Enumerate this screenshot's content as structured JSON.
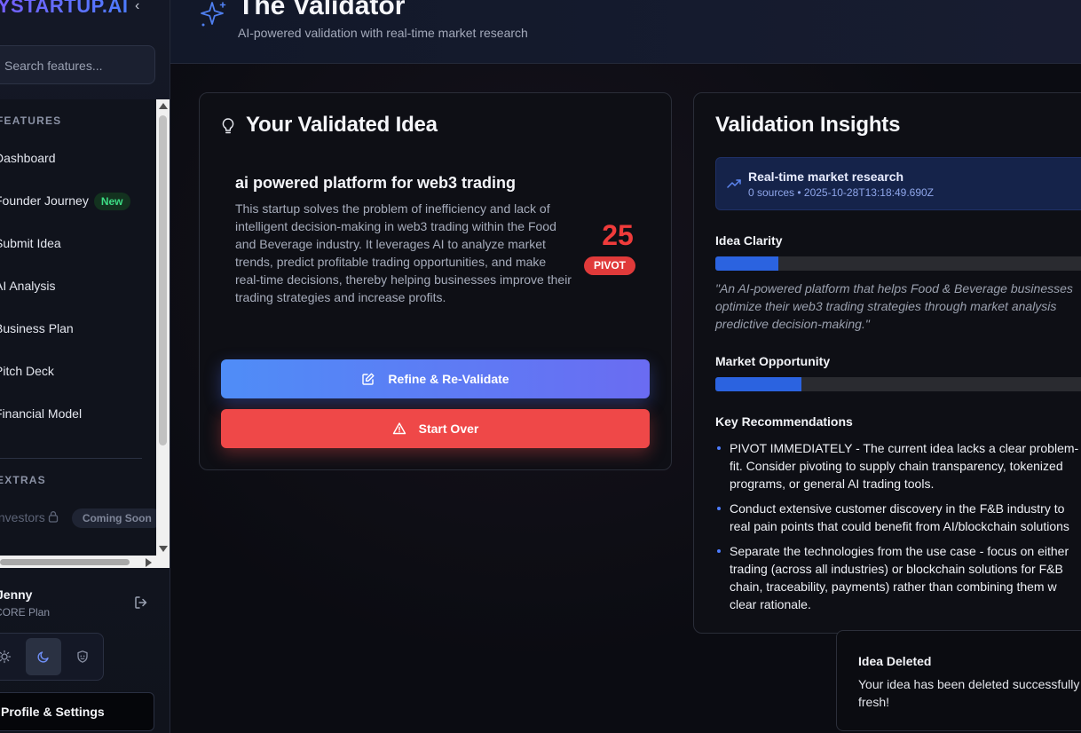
{
  "sidebar": {
    "brand": "MYSTARTUP.AI",
    "search_placeholder": "Search features...",
    "sections": {
      "features": "FEATURES",
      "extras": "EXTRAS"
    },
    "items": [
      {
        "label": "Dashboard"
      },
      {
        "label": "Founder Journey",
        "badge": "New"
      },
      {
        "label": "Submit Idea"
      },
      {
        "label": "AI Analysis"
      },
      {
        "label": "Business Plan"
      },
      {
        "label": "Pitch Deck"
      },
      {
        "label": "Financial Model"
      }
    ],
    "extras_item": {
      "label": "Investors",
      "badge": "Coming Soon"
    },
    "user": {
      "name": "Jenny",
      "plan": "CORE Plan"
    },
    "settings_label": "Profile & Settings"
  },
  "header": {
    "title": "The Validator",
    "subtitle": "AI-powered validation with real-time market research"
  },
  "idea_card": {
    "title": "Your Validated Idea",
    "idea_name": "ai powered platform for web3 trading",
    "description": "This startup solves the problem of inefficiency and lack of intelligent decision-making in web3 trading within the Food and Beverage industry. It leverages AI to analyze market trends, predict profitable trading opportunities, and make real-time decisions, thereby helping businesses improve their trading strategies and increase profits.",
    "score": "25",
    "verdict": "PIVOT",
    "refine_label": "Refine & Re-Validate",
    "start_over_label": "Start Over"
  },
  "insights": {
    "title": "Validation Insights",
    "research_title": "Real-time market research",
    "research_meta": "0 sources • 2025-10-28T13:18:49.690Z",
    "clarity_label": "Idea Clarity",
    "clarity_fraction": 0.17,
    "clarity_quote_lines": [
      "\"An AI-powered platform that helps Food & Beverage businesses",
      "optimize their web3 trading strategies through market analysis",
      "predictive decision-making.\""
    ],
    "market_label": "Market Opportunity",
    "market_fraction": 0.23,
    "recs_title": "Key Recommendations",
    "recommendations": [
      [
        "PIVOT IMMEDIATELY - The current idea lacks a clear problem-",
        "fit. Consider pivoting to supply chain transparency, tokenized",
        "programs, or general AI trading tools."
      ],
      [
        "Conduct extensive customer discovery in the F&B industry to",
        "real pain points that could benefit from AI/blockchain solutions"
      ],
      [
        "Separate the technologies from the use case - focus on either",
        "trading (across all industries) or blockchain solutions for F&B",
        "chain, traceability, payments) rather than combining them w",
        "clear rationale."
      ]
    ]
  },
  "toast": {
    "title": "Idea Deleted",
    "message_lines": [
      "Your idea has been deleted successfully",
      "fresh!"
    ]
  }
}
